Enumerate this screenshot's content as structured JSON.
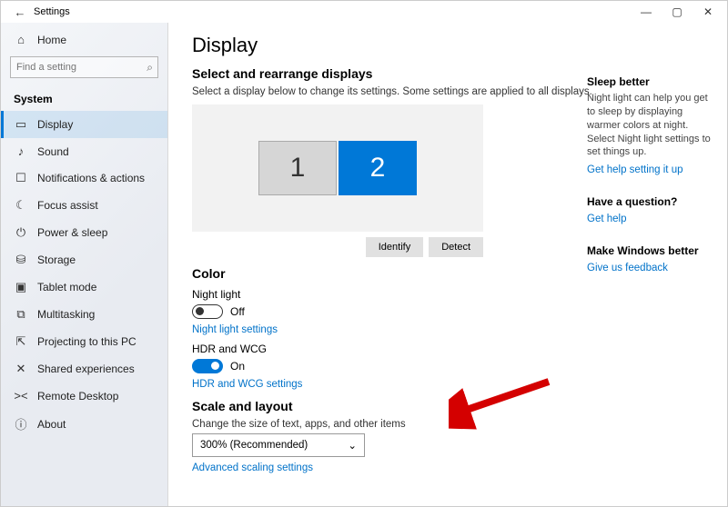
{
  "window": {
    "title": "Settings"
  },
  "sidebar": {
    "home": "Home",
    "search_placeholder": "Find a setting",
    "group": "System",
    "items": [
      {
        "icon": "▭",
        "label": "Display",
        "active": true
      },
      {
        "icon": "♪",
        "label": "Sound"
      },
      {
        "icon": "☐",
        "label": "Notifications & actions"
      },
      {
        "icon": "☾",
        "label": "Focus assist"
      },
      {
        "icon": "⏻",
        "label": "Power & sleep"
      },
      {
        "icon": "⛁",
        "label": "Storage"
      },
      {
        "icon": "▣",
        "label": "Tablet mode"
      },
      {
        "icon": "⧉",
        "label": "Multitasking"
      },
      {
        "icon": "⇱",
        "label": "Projecting to this PC"
      },
      {
        "icon": "✕",
        "label": "Shared experiences"
      },
      {
        "icon": "><",
        "label": "Remote Desktop"
      },
      {
        "icon": "ⓘ",
        "label": "About"
      }
    ]
  },
  "main": {
    "title": "Display",
    "select_h": "Select and rearrange displays",
    "select_desc": "Select a display below to change its settings. Some settings are applied to all displays.",
    "monitors": [
      "1",
      "2"
    ],
    "identify_btn": "Identify",
    "detect_btn": "Detect",
    "color_h": "Color",
    "night_label": "Night light",
    "night_state": "Off",
    "night_link": "Night light settings",
    "hdr_label": "HDR and WCG",
    "hdr_state": "On",
    "hdr_link": "HDR and WCG settings",
    "scale_h": "Scale and layout",
    "scale_desc": "Change the size of text, apps, and other items",
    "scale_value": "300% (Recommended)",
    "adv_scale_link": "Advanced scaling settings"
  },
  "side": {
    "sleep_h": "Sleep better",
    "sleep_p": "Night light can help you get to sleep by displaying warmer colors at night. Select Night light settings to set things up.",
    "sleep_link": "Get help setting it up",
    "q_h": "Have a question?",
    "q_link": "Get help",
    "fb_h": "Make Windows better",
    "fb_link": "Give us feedback"
  }
}
